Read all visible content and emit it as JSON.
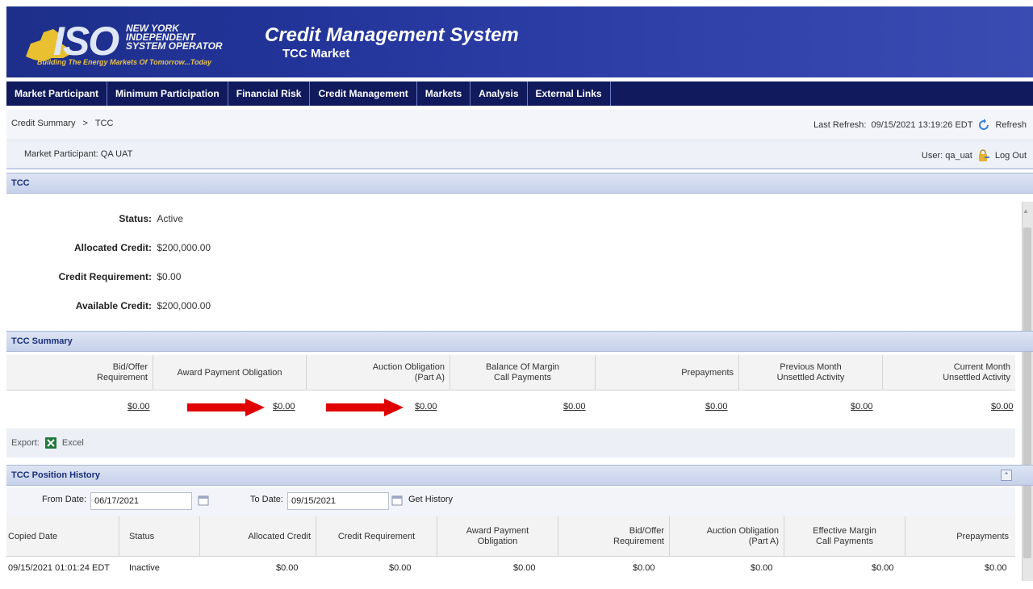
{
  "header": {
    "logo_text": "ISO",
    "logo_name_line1": "NEW YORK",
    "logo_name_line2": "INDEPENDENT",
    "logo_name_line3": "SYSTEM OPERATOR",
    "logo_tagline": "Building The Energy Markets Of Tomorrow...Today",
    "title": "Credit Management System",
    "subtitle": "TCC Market"
  },
  "nav": {
    "items": [
      "Market Participant",
      "Minimum Participation",
      "Financial Risk",
      "Credit Management",
      "Markets",
      "Analysis",
      "External Links"
    ]
  },
  "breadcrumb": {
    "root": "Credit Summary",
    "separator": ">",
    "current": "TCC"
  },
  "refresh": {
    "label": "Last Refresh:",
    "timestamp": "09/15/2021 13:19:26 EDT",
    "button": "Refresh"
  },
  "participant": {
    "label": "Market Participant: QA UAT"
  },
  "user": {
    "label": "User: qa_uat",
    "logout": "Log Out"
  },
  "tcc": {
    "section_title": "TCC",
    "status_label": "Status:",
    "status_value": "Active",
    "allocated_label": "Allocated Credit:",
    "allocated_value": "$200,000.00",
    "requirement_label": "Credit Requirement:",
    "requirement_value": "$0.00",
    "available_label": "Available Credit:",
    "available_value": "$200,000.00"
  },
  "summary": {
    "section_title": "TCC Summary",
    "headers": [
      "Bid/Offer\nRequirement",
      "Award Payment Obligation",
      "Auction Obligation\n(Part A)",
      "Balance Of Margin\nCall Payments",
      "Prepayments",
      "Previous Month\nUnsettled Activity",
      "Current Month\nUnsettled Activity"
    ],
    "values": [
      "$0.00",
      "$0.00",
      "$0.00",
      "$0.00",
      "$0.00",
      "$0.00",
      "$0.00"
    ]
  },
  "export": {
    "label": "Export:",
    "excel": "Excel"
  },
  "history": {
    "section_title": "TCC Position History",
    "from_label": "From Date:",
    "from_value": "06/17/2021",
    "to_label": "To Date:",
    "to_value": "09/15/2021",
    "get_history": "Get History",
    "headers": [
      "Copied Date",
      "Status",
      "Allocated Credit",
      "Credit Requirement",
      "Award Payment\nObligation",
      "Bid/Offer\nRequirement",
      "Auction Obligation\n(Part A)",
      "Effective Margin\nCall Payments",
      "Prepayments"
    ],
    "rows": [
      [
        "09/15/2021 01:01:24 EDT",
        "Inactive",
        "$0.00",
        "$0.00",
        "$0.00",
        "$0.00",
        "$0.00",
        "$0.00",
        "$0.00"
      ]
    ]
  },
  "colors": {
    "banner": "#23349a",
    "navbar": "#101a5c",
    "section_header": "#c6d1ea",
    "arrow": "#e00000",
    "logo_tagline": "#e8c24a"
  }
}
